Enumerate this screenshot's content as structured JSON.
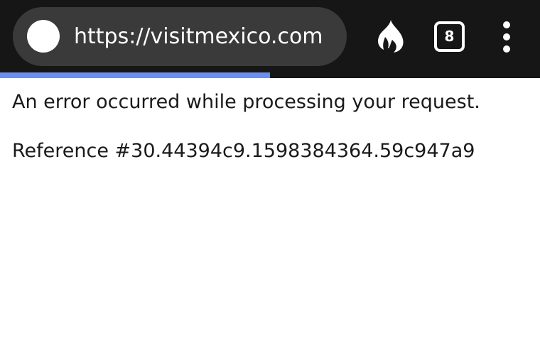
{
  "browser": {
    "url": "https://visitmexico.com",
    "tab_count": "8",
    "loading_progress_percent": 50,
    "icons": {
      "site": "site-favicon-icon",
      "fire": "fire-icon",
      "tabs": "tab-switcher-icon",
      "menu": "overflow-menu-icon"
    },
    "colors": {
      "toolbar": "#161616",
      "url_bar": "#3a3a3a",
      "progress": "#6a8ff2"
    }
  },
  "page": {
    "error_message": "An error occurred while processing your request.",
    "reference": "Reference #30.44394c9.1598384364.59c947a9"
  }
}
